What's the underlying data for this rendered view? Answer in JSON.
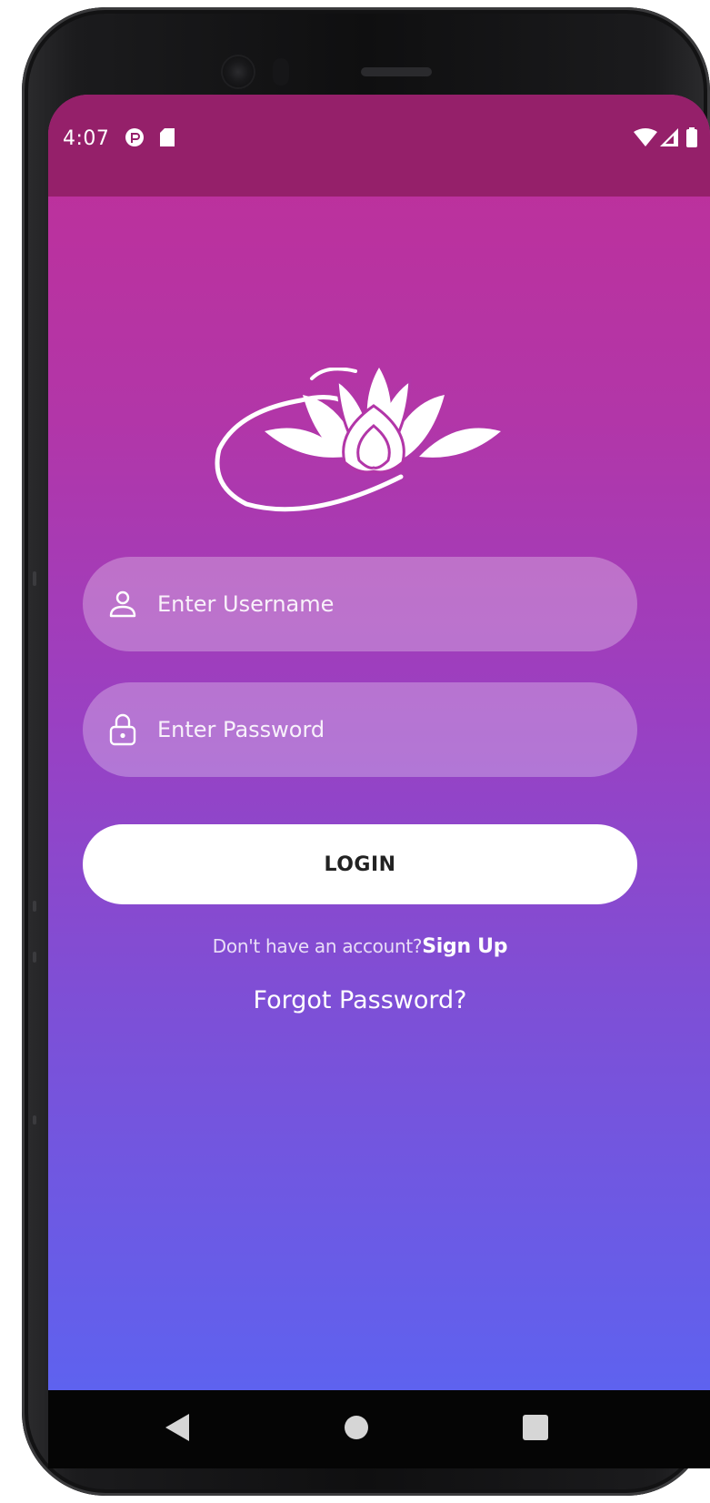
{
  "status_bar": {
    "time": "4:07",
    "left_icons": [
      "sync-icon",
      "sd-card-icon"
    ],
    "right_icons": [
      "wifi-icon",
      "cell-signal-icon",
      "battery-icon"
    ]
  },
  "login_form": {
    "username_placeholder": "Enter Username",
    "username_value": "",
    "password_placeholder": "Enter Password",
    "password_value": "",
    "login_label": "LOGIN",
    "no_account_text": "Don't have an account?",
    "signup_label": "Sign Up",
    "forgot_label": "Forgot Password?"
  },
  "nav_bar": {
    "buttons": [
      "back",
      "home",
      "recents"
    ]
  },
  "colors": {
    "status_bar": "#95206a",
    "gradient_top": "#c02f98",
    "gradient_bottom": "#5e62ef",
    "button_bg": "#ffffff",
    "button_text": "#222222"
  }
}
